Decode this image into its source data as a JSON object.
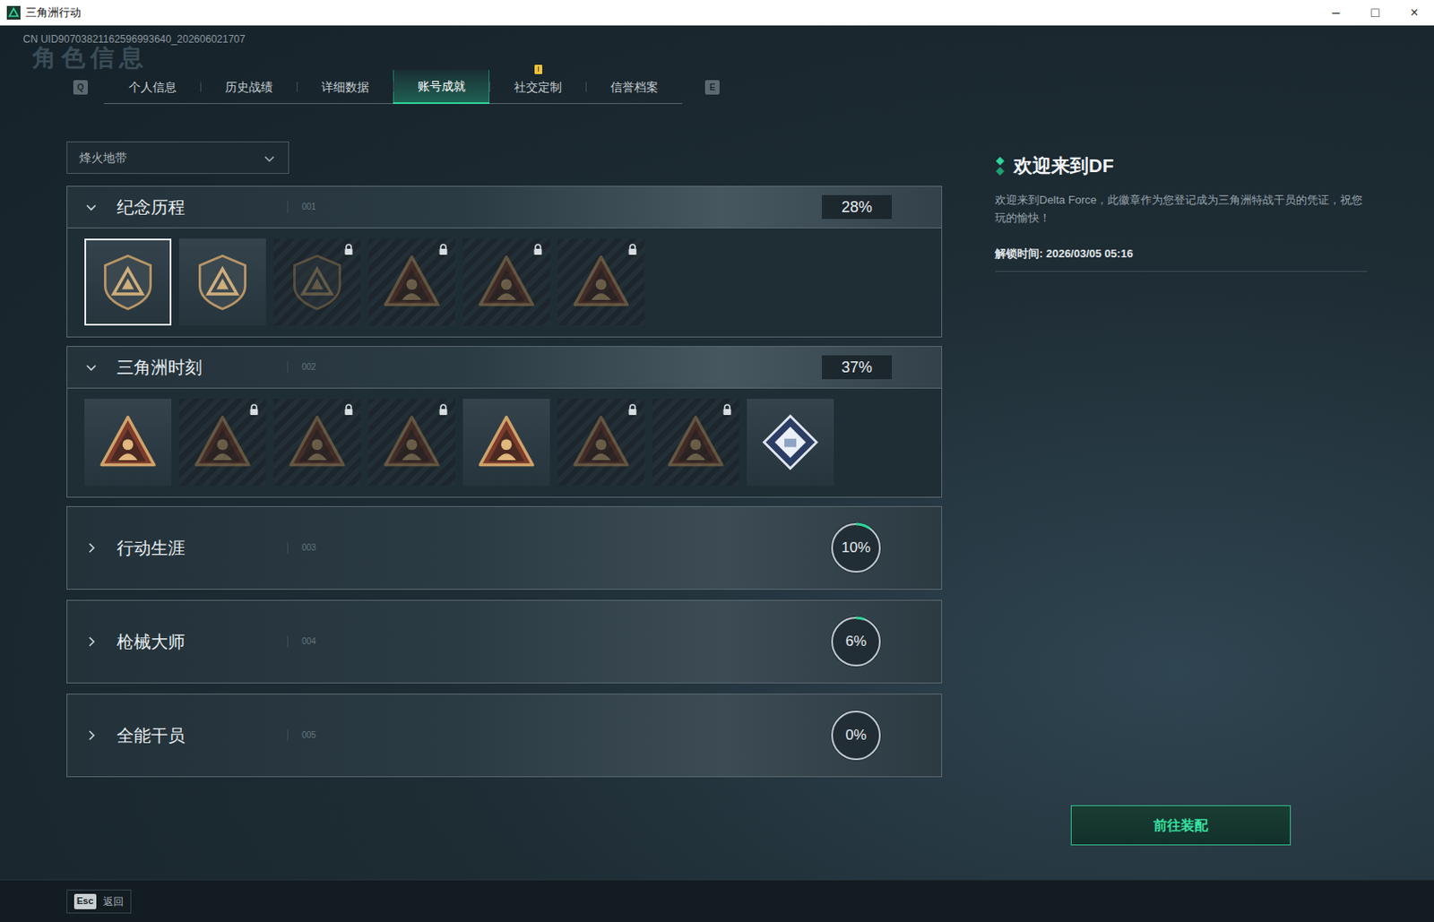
{
  "window": {
    "title": "三角洲行动",
    "controls": [
      "–",
      "□",
      "×"
    ]
  },
  "uid": "CN UID90703821162596993640_202606021707",
  "page_title": "角色信息",
  "tab_keys": {
    "prev": "Q",
    "next": "E"
  },
  "tabs": [
    {
      "label": "个人信息",
      "selected": false,
      "alert": false
    },
    {
      "label": "历史战绩",
      "selected": false,
      "alert": false
    },
    {
      "label": "详细数据",
      "selected": false,
      "alert": false
    },
    {
      "label": "账号成就",
      "selected": true,
      "alert": false
    },
    {
      "label": "社交定制",
      "selected": false,
      "alert": true
    },
    {
      "label": "信誉档案",
      "selected": false,
      "alert": false
    }
  ],
  "mode_select": {
    "value": "烽火地带"
  },
  "sections": [
    {
      "title": "纪念历程",
      "code": "001",
      "expanded": true,
      "percent": "28%",
      "badges": [
        {
          "kind": "shield",
          "locked": false,
          "selected": true
        },
        {
          "kind": "shield",
          "locked": false,
          "selected": false
        },
        {
          "kind": "shield",
          "locked": true,
          "selected": false
        },
        {
          "kind": "triangle",
          "locked": true,
          "selected": false
        },
        {
          "kind": "triangle",
          "locked": true,
          "selected": false
        },
        {
          "kind": "triangle",
          "locked": true,
          "selected": false
        }
      ]
    },
    {
      "title": "三角洲时刻",
      "code": "002",
      "expanded": true,
      "percent": "37%",
      "badges": [
        {
          "kind": "triangle",
          "locked": false,
          "selected": false
        },
        {
          "kind": "triangle",
          "locked": true,
          "selected": false
        },
        {
          "kind": "triangle",
          "locked": true,
          "selected": false
        },
        {
          "kind": "triangle",
          "locked": true,
          "selected": false
        },
        {
          "kind": "triangle",
          "locked": false,
          "selected": false
        },
        {
          "kind": "triangle",
          "locked": true,
          "selected": false
        },
        {
          "kind": "triangle",
          "locked": true,
          "selected": false
        },
        {
          "kind": "diamond",
          "locked": false,
          "selected": false
        }
      ]
    },
    {
      "title": "行动生涯",
      "code": "003",
      "expanded": false,
      "percent": "10%",
      "level": 0.1
    },
    {
      "title": "枪械大师",
      "code": "004",
      "expanded": false,
      "percent": "6%",
      "level": 0.06
    },
    {
      "title": "全能干员",
      "code": "005",
      "expanded": false,
      "percent": "0%",
      "level": 0
    }
  ],
  "detail": {
    "title": "欢迎来到DF",
    "description": "欢迎来到Delta Force，此徽章作为您登记成为三角洲特战干员的凭证，祝您玩的愉快！",
    "unlock_time": "解锁时间: 2026/03/05 05:16"
  },
  "equip_button": "前往装配",
  "footer": {
    "key": "Esc",
    "label": "返回"
  }
}
